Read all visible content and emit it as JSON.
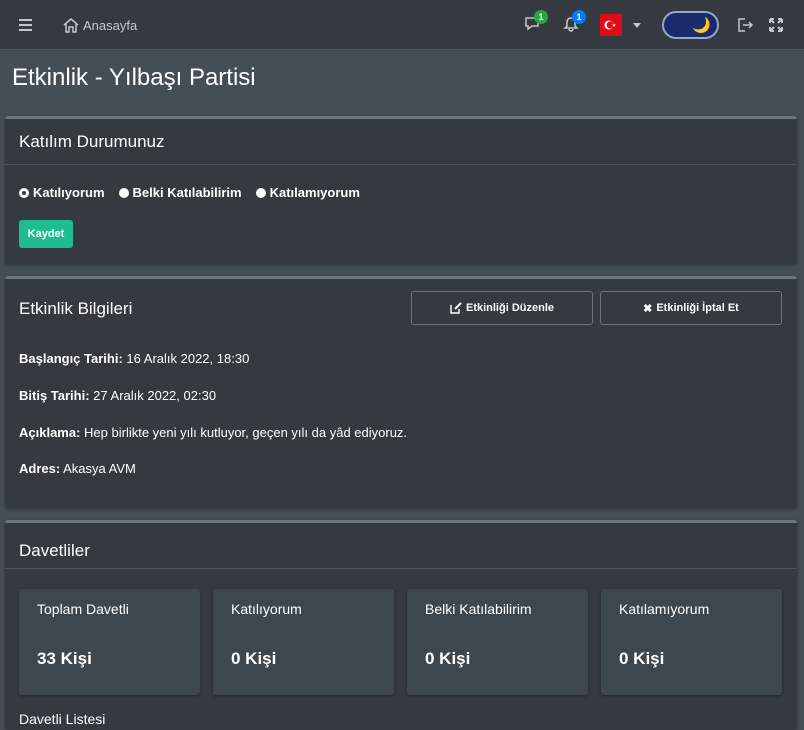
{
  "navbar": {
    "home_label": "Anasayfa",
    "messages_badge": "1",
    "notifications_badge": "1",
    "flag_text": "C*"
  },
  "page": {
    "title": "Etkinlik - Yılbaşı Partisi"
  },
  "attendance": {
    "title": "Katılım Durumunuz",
    "options": [
      "Katılıyorum",
      "Belki Katılabilirim",
      "Katılamıyorum"
    ],
    "selected": "Katılıyorum",
    "save_label": "Kaydet"
  },
  "event_info": {
    "title": "Etkinlik Bilgileri",
    "edit_label": "Etkinliği Düzenle",
    "cancel_label": "Etkinliği İptal Et",
    "start_label": "Başlangıç Tarihi:",
    "start_value": "16 Aralık 2022, 18:30",
    "end_label": "Bitiş Tarihi:",
    "end_value": "27 Aralık 2022, 02:30",
    "desc_label": "Açıklama:",
    "desc_value": "Hep birlikte yeni yılı kutluyor, geçen yılı da yâd ediyoruz.",
    "address_label": "Adres:",
    "address_value": "Akasya AVM"
  },
  "invitees": {
    "title": "Davetliler",
    "stats": [
      {
        "label": "Toplam Davetli",
        "value": "33 Kişi"
      },
      {
        "label": "Katılıyorum",
        "value": "0 Kişi"
      },
      {
        "label": "Belki Katılabilirim",
        "value": "0 Kişi"
      },
      {
        "label": "Katılamıyorum",
        "value": "0 Kişi"
      }
    ],
    "list_title": "Davetli Listesi"
  },
  "colors": {
    "background": "#454d55",
    "card": "#343a40",
    "accent_green": "#1dbd8f",
    "flag_red": "#e30a17"
  }
}
